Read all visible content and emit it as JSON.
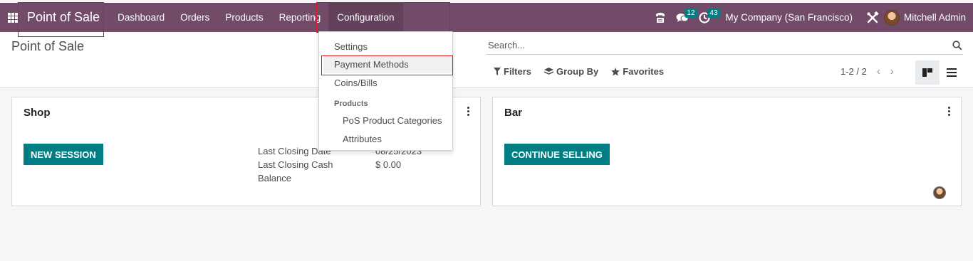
{
  "navbar": {
    "app_name": "Point of Sale",
    "menu": [
      "Dashboard",
      "Orders",
      "Products",
      "Reporting",
      "Configuration"
    ],
    "active_menu": "Configuration",
    "systray": {
      "messages_count": "12",
      "activities_count": "43",
      "company": "My Company (San Francisco)",
      "user": "Mitchell Admin"
    }
  },
  "control_panel": {
    "title": "Point of Sale",
    "search_placeholder": "Search...",
    "filters_label": "Filters",
    "group_by_label": "Group By",
    "favorites_label": "Favorites",
    "pager": "1-2 / 2"
  },
  "configuration_dropdown": {
    "items": [
      "Settings",
      "Payment Methods",
      "Coins/Bills"
    ],
    "section_header": "Products",
    "section_items": [
      "PoS Product Categories",
      "Attributes"
    ]
  },
  "cards": [
    {
      "name": "Shop",
      "button": "NEW SESSION",
      "info": [
        {
          "label": "Last Closing Date",
          "value": "08/25/2023"
        },
        {
          "label": "Last Closing Cash",
          "value": "$ 0.00"
        },
        {
          "label": "Balance",
          "value": ""
        }
      ]
    },
    {
      "name": "Bar",
      "button": "CONTINUE SELLING"
    }
  ],
  "colors": {
    "navbar": "#714b67",
    "primary_button": "#017e84",
    "highlight": "#d8141c"
  }
}
